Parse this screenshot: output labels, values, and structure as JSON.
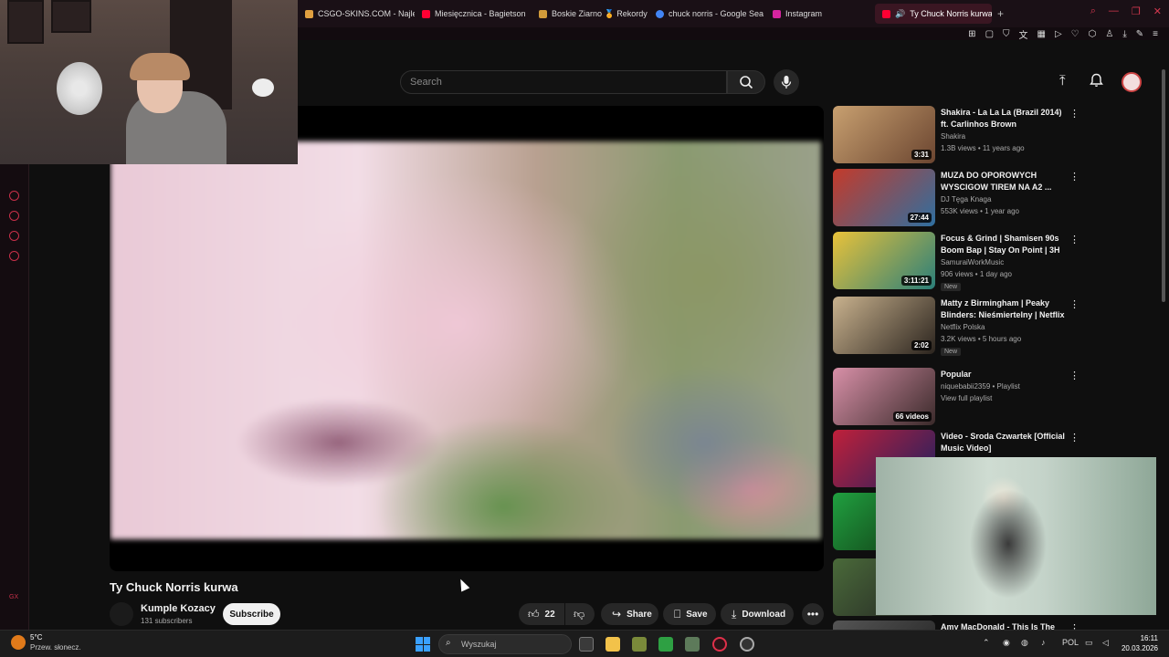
{
  "browser": {
    "tabs": [
      {
        "label": "CSGO-SKINS.COM - Najle",
        "color": "#e0a040"
      },
      {
        "label": "Miesięcznica - Bagietson",
        "color": "#ff0033"
      },
      {
        "label": "Boskie Ziarno 🏅 Rekordy",
        "color": "#d29b3a"
      },
      {
        "label": "chuck norris - Google Sea",
        "color": "#4285f4"
      },
      {
        "label": "Instagram",
        "color": "#d6249f"
      }
    ],
    "active_tab": {
      "label": "Ty Chuck Norris kurwa"
    }
  },
  "header": {
    "search_placeholder": "Search"
  },
  "video": {
    "title": "Ty Chuck Norris kurwa",
    "channel": "Kumple Kozacy",
    "subscribers": "131 subscribers",
    "subscribe_label": "Subscribe",
    "likes": "22",
    "share_label": "Share",
    "save_label": "Save",
    "download_label": "Download"
  },
  "recommendations": [
    {
      "title": "Shakira - La La La (Brazil 2014) ft. Carlinhos Brown",
      "channel": "Shakira",
      "meta": "1.3B views • 11 years ago",
      "duration": "3:31",
      "new": "",
      "colors": [
        "#c8a070",
        "#6b4530"
      ]
    },
    {
      "title": "MUZA DO OPOROWYCH WYSCIGOW TIREM NA A2 ...",
      "channel": "DJ Tęga Knaga",
      "meta": "553K views • 1 year ago",
      "duration": "27:44",
      "new": "",
      "colors": [
        "#c43a2a",
        "#2f6fa0"
      ]
    },
    {
      "title": "Focus & Grind | Shamisen 90s Boom Bap | Stay On Point | 3H",
      "channel": "SamuraiWorkMusic",
      "meta": "906 views • 1 day ago",
      "duration": "3:11:21",
      "new": "New",
      "colors": [
        "#e9c23a",
        "#2a7f7a"
      ]
    },
    {
      "title": "Matty z Birmingham | Peaky Blinders: Nieśmiertelny | Netflix",
      "channel": "Netflix Polska",
      "meta": "3.2K views • 5 hours ago",
      "duration": "2:02",
      "new": "New",
      "colors": [
        "#c9b28e",
        "#2b241e"
      ]
    },
    {
      "title": "Popular",
      "channel": "niquebabii2359 • Playlist",
      "meta": "View full playlist",
      "duration": "66 videos",
      "new": "",
      "colors": [
        "#d890a8",
        "#3a2a2a"
      ]
    },
    {
      "title": "Video - Sroda Czwartek [Official Music Video]",
      "channel": "",
      "meta": "",
      "duration": "",
      "new": "",
      "colors": [
        "#c0203a",
        "#202060"
      ]
    },
    {
      "title": "",
      "channel": "",
      "meta": "",
      "duration": "",
      "new": "",
      "colors": [
        "#20a040",
        "#103010"
      ]
    },
    {
      "title": "",
      "channel": "",
      "meta": "",
      "duration": "",
      "new": "",
      "colors": [
        "#4a6a3a",
        "#222"
      ]
    },
    {
      "title": "Amy MacDonald - This Is The",
      "channel": "",
      "meta": "",
      "duration": "",
      "new": "",
      "colors": [
        "#555",
        "#222"
      ]
    }
  ],
  "taskbar": {
    "temp": "5°C",
    "weather": "Przew. słonecz.",
    "search_placeholder": "Wyszukaj",
    "language": "POL",
    "time": "16:11",
    "date": "20.03.2026"
  },
  "sidebar": {
    "label": "GX"
  },
  "colors": {
    "accent": "#ff0033",
    "opera": "#c9304a"
  }
}
